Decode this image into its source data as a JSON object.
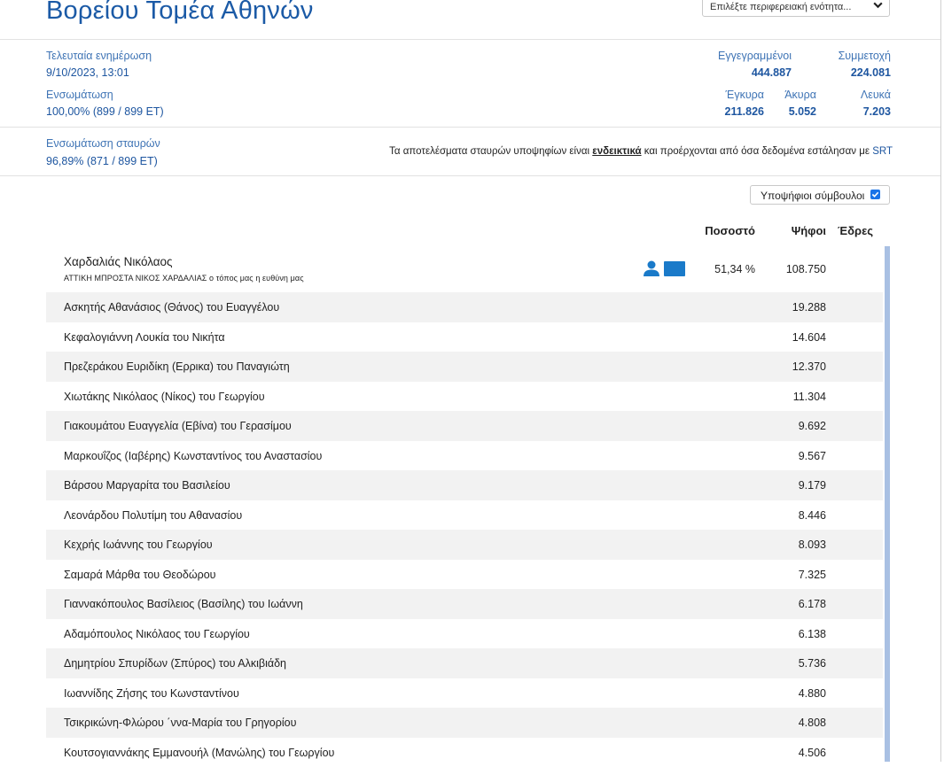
{
  "page_title": "Βορείου Τομέα Αθηνών",
  "region_select": {
    "selected": "Επιλέξτε περιφερειακή ενότητα..."
  },
  "stats": {
    "last_update_label": "Τελευταία ενημέρωση",
    "last_update_value": "9/10/2023, 13:01",
    "integration_label": "Ενσωμάτωση",
    "integration_value": "100,00% (899 / 899 ΕΤ)",
    "registered_label": "Εγγεγραμμένοι",
    "registered_value": "444.887",
    "turnout_label": "Συμμετοχή",
    "turnout_value": "224.081",
    "valid_label": "Έγκυρα",
    "valid_value": "211.826",
    "invalid_label": "Άκυρα",
    "invalid_value": "5.052",
    "blank_label": "Λευκά",
    "blank_value": "7.203",
    "cross_integration_label": "Ενσωμάτωση σταυρών",
    "cross_integration_value": "96,89% (871 / 899 ΕΤ)"
  },
  "note": {
    "before": "Τα αποτελέσματα σταυρών υποψηφίων είναι ",
    "link": "ενδεικτικά",
    "middle": " και προέρχονται από όσα δεδομένα εστάλησαν με ",
    "srt": "SRT"
  },
  "toggle": {
    "label": "Υποψήφιοι σύμβουλοι",
    "checked": true
  },
  "table": {
    "headers": {
      "percent": "Ποσοστό",
      "votes": "Ψήφοι",
      "seats": "Έδρες"
    },
    "leader": {
      "name": "Χαρδαλιάς Νικόλαος",
      "party": "ΑΤΤΙΚΗ ΜΠΡΟΣΤΑ ΝΙΚΟΣ ΧΑΡΔΑΛΙΑΣ ο τόπος μας η ευθύνη μας",
      "percent": "51,34 %",
      "votes": "108.750"
    },
    "candidates": [
      {
        "name": "Ασκητής Αθανάσιος (Θάνος) του Ευαγγέλου",
        "votes": "19.288"
      },
      {
        "name": "Κεφαλογιάννη Λουκία του Νικήτα",
        "votes": "14.604"
      },
      {
        "name": "Πρεζεράκου Ευριδίκη (Ερρικα) του Παναγιώτη",
        "votes": "12.370"
      },
      {
        "name": "Χιωτάκης Νικόλαος (Νίκος) του Γεωργίου",
        "votes": "11.304"
      },
      {
        "name": "Γιακουμάτου Ευαγγελία (Εβίνα) του Γερασίμου",
        "votes": "9.692"
      },
      {
        "name": "Μαρκουΐζος (Ιαβέρης) Κωνσταντίνος του Αναστασίου",
        "votes": "9.567"
      },
      {
        "name": "Βάρσου Μαργαρίτα του Βασιλείου",
        "votes": "9.179"
      },
      {
        "name": "Λεονάρδου Πολυτίμη του Αθανασίου",
        "votes": "8.446"
      },
      {
        "name": "Κεχρής Ιωάννης του Γεωργίου",
        "votes": "8.093"
      },
      {
        "name": "Σαμαρά Μάρθα του Θεοδώρου",
        "votes": "7.325"
      },
      {
        "name": "Γιαννακόπουλος Βασίλειος (Βασίλης) του Ιωάννη",
        "votes": "6.178"
      },
      {
        "name": "Αδαμόπουλος Νικόλαος του Γεωργίου",
        "votes": "6.138"
      },
      {
        "name": "Δημητρίου Σπυρίδων (Σπύρος) του Αλκιβιάδη",
        "votes": "5.736"
      },
      {
        "name": "Ιωαννίδης Ζήσης του Κωνσταντίνου",
        "votes": "4.880"
      },
      {
        "name": "Τσικρικώνη-Φλώρου ΄ννα-Μαρία του Γρηγορίου",
        "votes": "4.808"
      },
      {
        "name": "Κουτσογιαννάκης Εμμανουήλ (Μανώλης) του Γεωργίου",
        "votes": "4.506"
      }
    ]
  },
  "colors": {
    "accent": "#1b5aa6",
    "label_blue": "#3f74b5",
    "icon_blue": "#1a7ac9",
    "row_shade": "#f2f2f2",
    "scrollbar": "#a9c0e3"
  },
  "icons": {
    "leader_person": "person-icon",
    "leader_party": "card-icon",
    "select_chevron": "chevron-down-icon",
    "checkbox": "checkbox-checked-icon"
  }
}
